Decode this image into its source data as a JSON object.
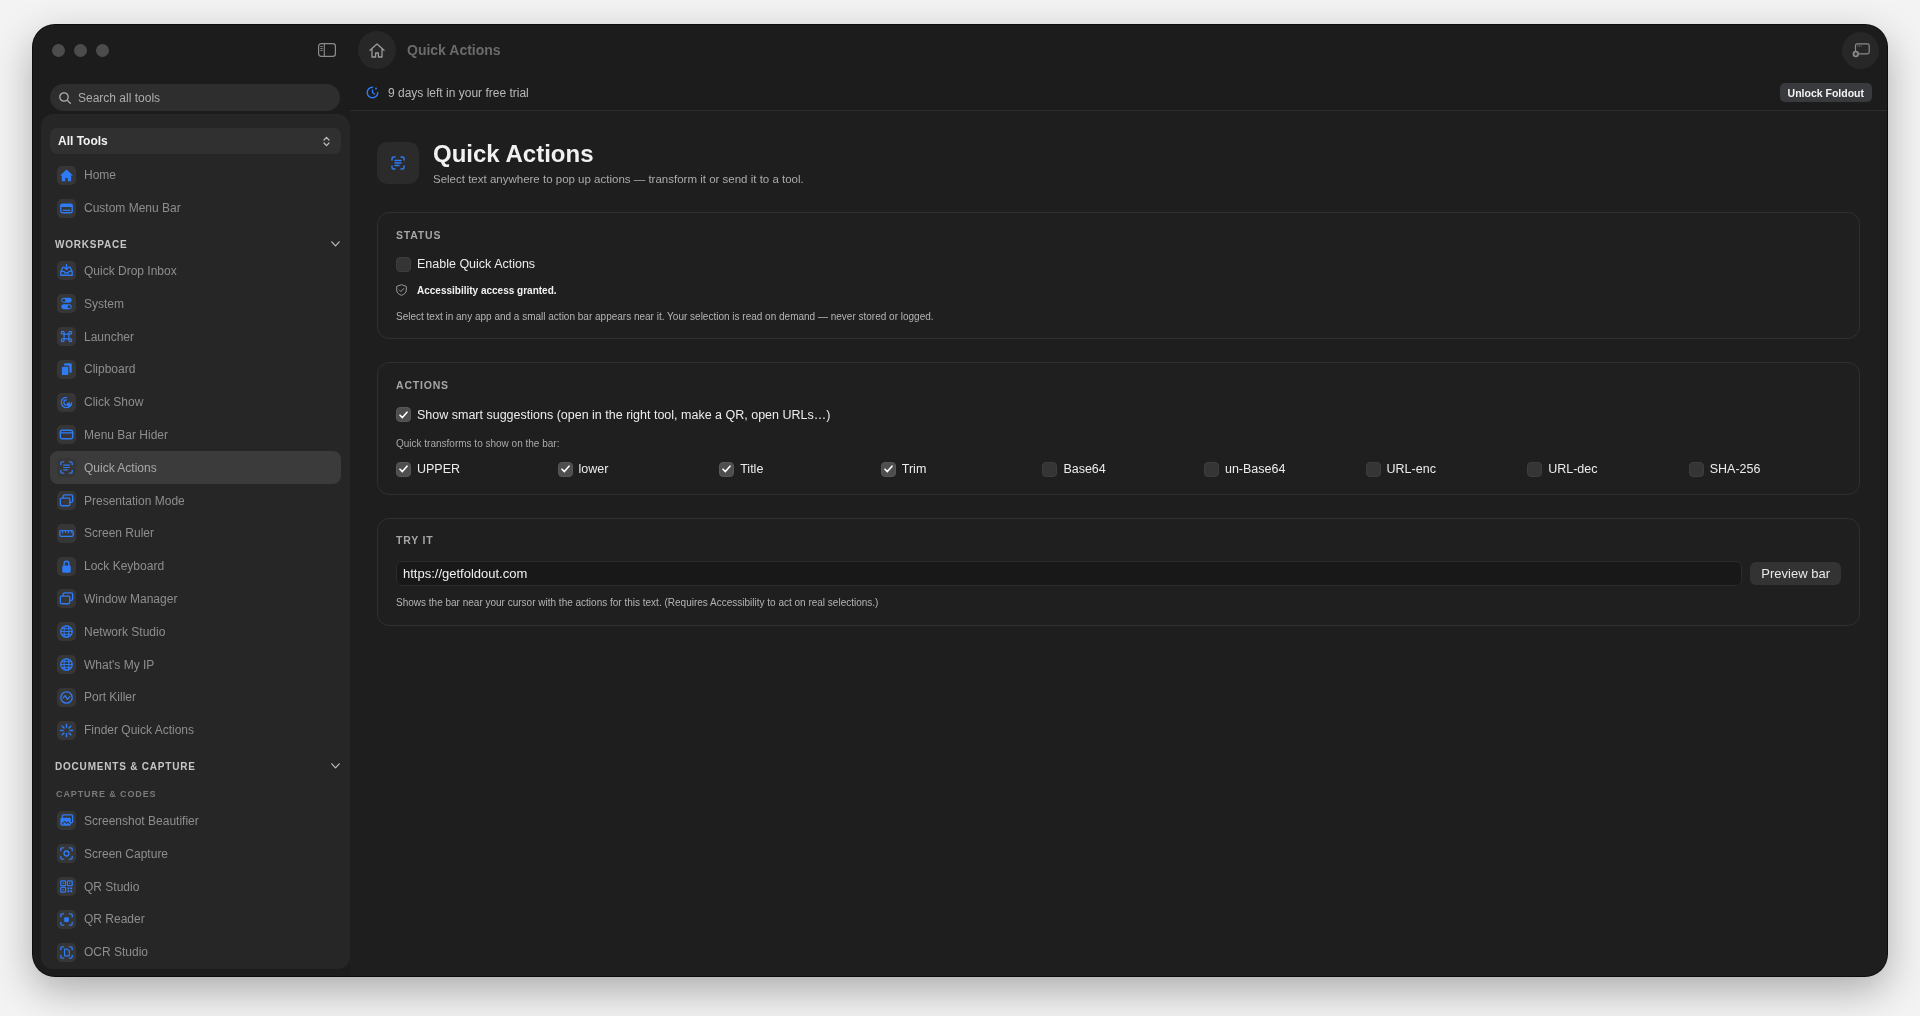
{
  "window": {
    "title": "Quick Actions"
  },
  "sidebar": {
    "search": {
      "placeholder": "Search all tools"
    },
    "filter": {
      "value": "All Tools"
    },
    "items": [
      {
        "label": "Home",
        "selected": false
      },
      {
        "label": "Custom Menu Bar",
        "selected": false
      }
    ],
    "sections": [
      {
        "title": "WORKSPACE",
        "expanded": true,
        "items": [
          {
            "label": "Quick Drop Inbox",
            "selected": false
          },
          {
            "label": "System",
            "selected": false
          },
          {
            "label": "Launcher",
            "selected": false
          },
          {
            "label": "Clipboard",
            "selected": false
          },
          {
            "label": "Click Show",
            "selected": false
          },
          {
            "label": "Menu Bar Hider",
            "selected": false
          },
          {
            "label": "Quick Actions",
            "selected": true
          },
          {
            "label": "Presentation Mode",
            "selected": false
          },
          {
            "label": "Screen Ruler",
            "selected": false
          },
          {
            "label": "Lock Keyboard",
            "selected": false
          },
          {
            "label": "Window Manager",
            "selected": false
          },
          {
            "label": "Network Studio",
            "selected": false
          },
          {
            "label": "What's My IP",
            "selected": false
          },
          {
            "label": "Port Killer",
            "selected": false
          },
          {
            "label": "Finder Quick Actions",
            "selected": false
          }
        ]
      },
      {
        "title": "DOCUMENTS & CAPTURE",
        "expanded": true,
        "groups": [
          {
            "title": "CAPTURE & CODES",
            "items": [
              {
                "label": "Screenshot Beautifier",
                "selected": false
              },
              {
                "label": "Screen Capture",
                "selected": false
              },
              {
                "label": "QR Studio",
                "selected": false
              },
              {
                "label": "QR Reader",
                "selected": false
              },
              {
                "label": "OCR Studio",
                "selected": false
              }
            ]
          }
        ]
      }
    ]
  },
  "trial_banner": {
    "text": "9 days left in your free trial",
    "button": "Unlock Foldout"
  },
  "page": {
    "title": "Quick Actions",
    "subtitle": "Select text anywhere to pop up actions — transform it or send it to a tool."
  },
  "cards": [
    {
      "kind": "status",
      "title": "STATUS",
      "toggle": {
        "label": "Enable Quick Actions",
        "checked": false
      },
      "note": "Accessibility access granted.",
      "description": "Select text in any app and a small action bar appears near it. Your selection is read on demand — never stored or logged."
    },
    {
      "kind": "actions",
      "title": "ACTIONS",
      "option": {
        "label": "Show smart suggestions (open in the right tool, make a QR, open URLs…)",
        "checked": true
      },
      "transforms_label": "Quick transforms to show on the bar:",
      "transforms": [
        {
          "label": "UPPER",
          "checked": true
        },
        {
          "label": "lower",
          "checked": true
        },
        {
          "label": "Title",
          "checked": true
        },
        {
          "label": "Trim",
          "checked": true
        },
        {
          "label": "Base64",
          "checked": false
        },
        {
          "label": "un-Base64",
          "checked": false
        },
        {
          "label": "URL-enc",
          "checked": false
        },
        {
          "label": "URL-dec",
          "checked": false
        },
        {
          "label": "SHA-256",
          "checked": false
        }
      ]
    },
    {
      "kind": "try",
      "title": "TRY IT",
      "input": {
        "value": "https://getfoldout.com"
      },
      "button": "Preview bar",
      "description": "Shows the bar near your cursor with the actions for this text. (Requires Accessibility to act on real selections.)"
    }
  ]
}
